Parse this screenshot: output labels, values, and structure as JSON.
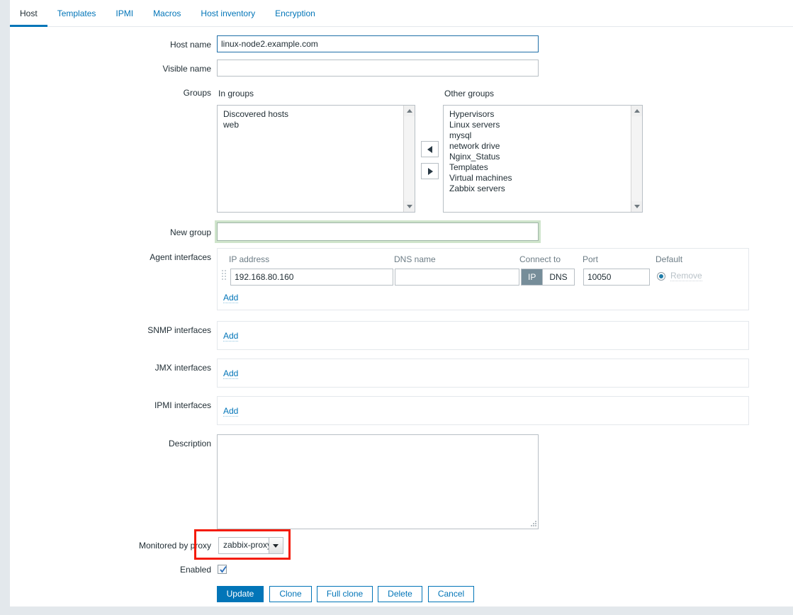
{
  "tabs": [
    {
      "label": "Host",
      "active": true
    },
    {
      "label": "Templates",
      "active": false
    },
    {
      "label": "IPMI",
      "active": false
    },
    {
      "label": "Macros",
      "active": false
    },
    {
      "label": "Host inventory",
      "active": false
    },
    {
      "label": "Encryption",
      "active": false
    }
  ],
  "form": {
    "host_name": {
      "label": "Host name",
      "value": "linux-node2.example.com",
      "placeholder": ""
    },
    "visible_name": {
      "label": "Visible name",
      "value": "",
      "placeholder": ""
    },
    "groups": {
      "label": "Groups",
      "in_groups_label": "In groups",
      "other_groups_label": "Other groups",
      "in_groups": [
        "Discovered hosts",
        "web"
      ],
      "other_groups": [
        "Hypervisors",
        "Linux servers",
        "mysql",
        "network drive",
        "Nginx_Status",
        "Templates",
        "Virtual machines",
        "Zabbix servers"
      ],
      "move_left_icon": "triangle-left-icon",
      "move_right_icon": "triangle-right-icon"
    },
    "new_group": {
      "label": "New group",
      "value": "",
      "placeholder": ""
    },
    "agent_interfaces": {
      "label": "Agent interfaces",
      "columns": [
        "IP address",
        "DNS name",
        "Connect to",
        "Port",
        "Default"
      ],
      "rows": [
        {
          "ip": "192.168.80.160",
          "dns": "",
          "connect_to": "IP",
          "connect_options": [
            "IP",
            "DNS"
          ],
          "port": "10050",
          "default_selected": true,
          "remove_label": "Remove"
        }
      ],
      "add_label": "Add"
    },
    "snmp_interfaces": {
      "label": "SNMP interfaces",
      "add_label": "Add"
    },
    "jmx_interfaces": {
      "label": "JMX interfaces",
      "add_label": "Add"
    },
    "ipmi_interfaces": {
      "label": "IPMI interfaces",
      "add_label": "Add"
    },
    "description": {
      "label": "Description",
      "value": "",
      "placeholder": ""
    },
    "monitored_by_proxy": {
      "label": "Monitored by proxy",
      "value": "zabbix-proxy",
      "dropdown_icon": "chevron-down-icon"
    },
    "enabled": {
      "label": "Enabled",
      "checked": true
    }
  },
  "buttons": {
    "update": "Update",
    "clone": "Clone",
    "full_clone": "Full clone",
    "delete": "Delete",
    "cancel": "Cancel"
  },
  "colors": {
    "accent": "#0275b8",
    "highlight": "#f41b09",
    "valid_glow": "#cfe4cb",
    "toggle_active": "#768d99"
  }
}
